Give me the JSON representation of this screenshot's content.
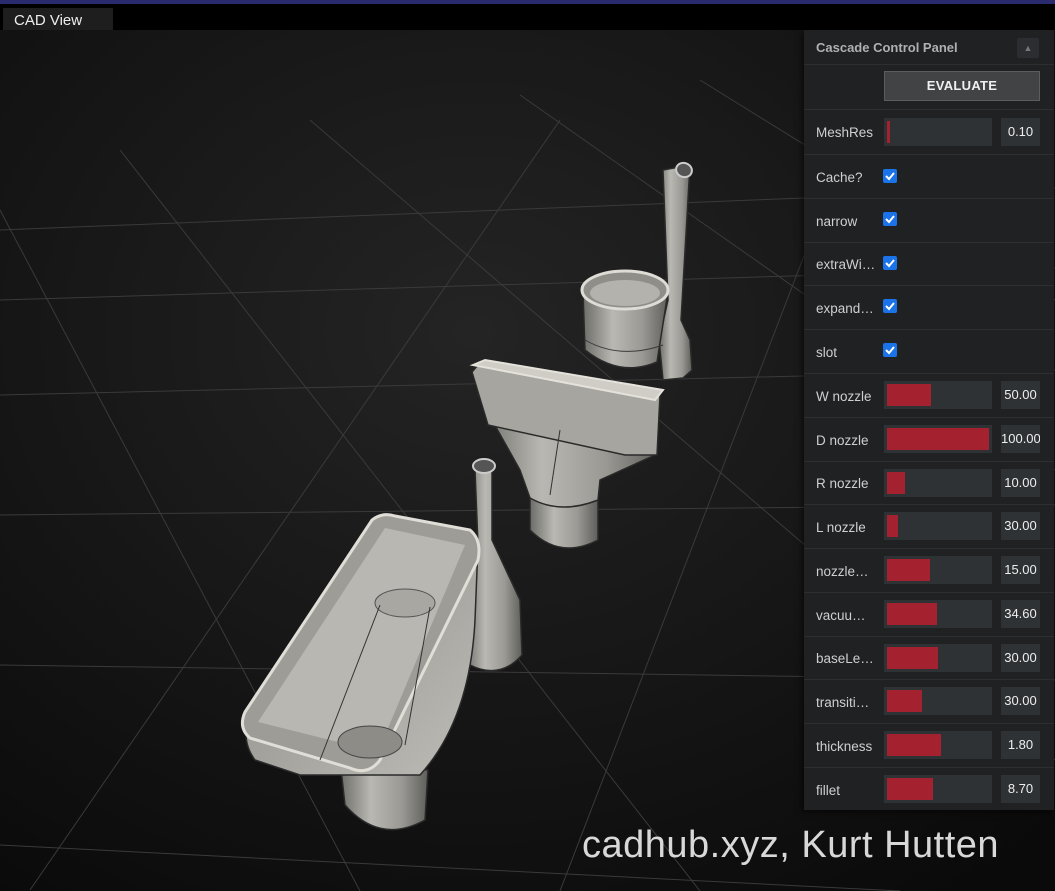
{
  "tab": {
    "label": "CAD View"
  },
  "panel": {
    "title": "Cascade Control Panel",
    "evaluate_label": "EVALUATE",
    "params": {
      "meshres": {
        "label": "MeshRes",
        "value": "0.10",
        "fill": 0.03
      },
      "cache": {
        "label": "Cache?",
        "checked": true
      },
      "narrow": {
        "label": "narrow",
        "checked": true
      },
      "extrawi": {
        "label": "extraWi…",
        "checked": true
      },
      "expand": {
        "label": "expand…",
        "checked": true
      },
      "slot": {
        "label": "slot",
        "checked": true
      },
      "w_nozzle": {
        "label": "W nozzle",
        "value": "50.00",
        "fill": 0.43
      },
      "d_nozzle": {
        "label": "D nozzle",
        "value": "100.00",
        "fill": 1.0
      },
      "r_nozzle": {
        "label": "R nozzle",
        "value": "10.00",
        "fill": 0.18
      },
      "l_nozzle": {
        "label": "L nozzle",
        "value": "30.00",
        "fill": 0.11
      },
      "nozzle": {
        "label": "nozzle…",
        "value": "15.00",
        "fill": 0.42
      },
      "vacuu": {
        "label": "vacuu…",
        "value": "34.60",
        "fill": 0.49
      },
      "basele": {
        "label": "baseLe…",
        "value": "30.00",
        "fill": 0.5
      },
      "transiti": {
        "label": "transiti…",
        "value": "30.00",
        "fill": 0.34
      },
      "thickness": {
        "label": "thickness",
        "value": "1.80",
        "fill": 0.53
      },
      "fillet": {
        "label": "fillet",
        "value": "8.70",
        "fill": 0.45
      }
    }
  },
  "watermark": "cadhub.xyz, Kurt Hutten",
  "colors": {
    "accent": "#a4212f",
    "checkbox": "#1a73e8",
    "panel_bg": "#1f2123",
    "tab_bg": "#1e1e1e"
  }
}
